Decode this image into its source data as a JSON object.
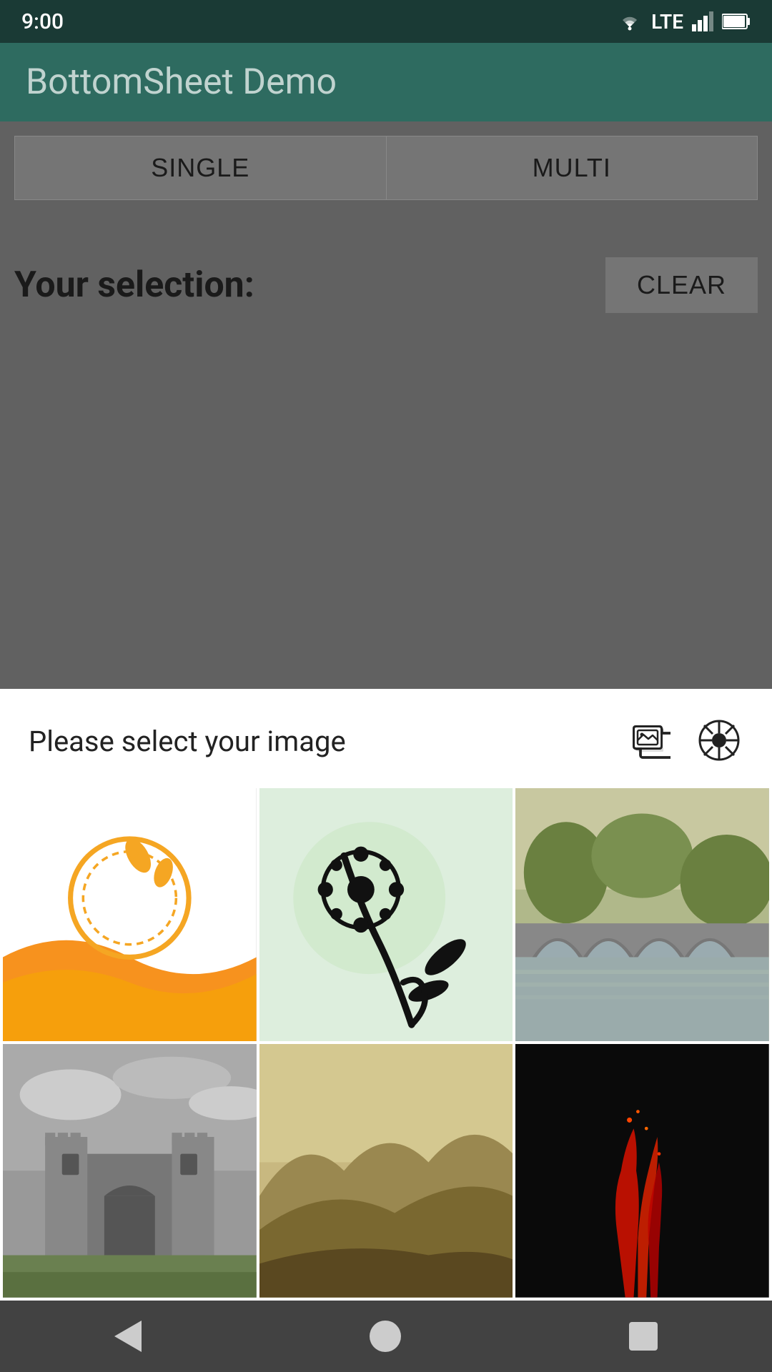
{
  "statusBar": {
    "time": "9:00",
    "network": "LTE"
  },
  "appBar": {
    "title": "BottomSheet Demo"
  },
  "tabs": [
    {
      "label": "SINGLE"
    },
    {
      "label": "MULTI"
    }
  ],
  "selectionSection": {
    "label": "Your selection:",
    "clearButton": "CLEAR"
  },
  "bottomSheet": {
    "title": "Please select your image",
    "galleryIconAlt": "gallery-icon",
    "cameraIconAlt": "camera-icon"
  },
  "images": [
    {
      "description": "yellow swirl abstract"
    },
    {
      "description": "black floral on green"
    },
    {
      "description": "stone bridge over river"
    },
    {
      "description": "castle ruins grayscale"
    },
    {
      "description": "mountain hills landscape"
    },
    {
      "description": "dark background with red plants"
    }
  ],
  "navBar": {
    "back": "back",
    "home": "home",
    "recents": "recents"
  }
}
